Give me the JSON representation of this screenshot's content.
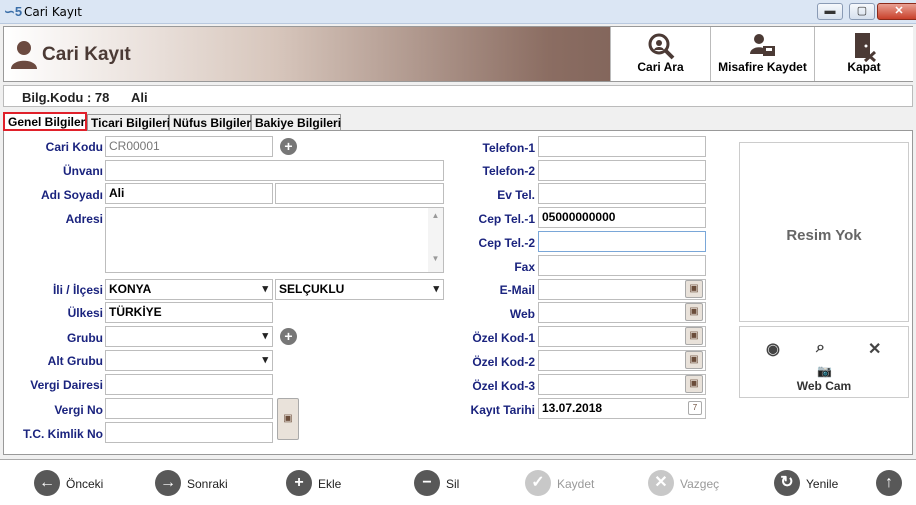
{
  "window": {
    "title": "Cari Kayıt"
  },
  "header": {
    "title": "Cari Kayıt"
  },
  "toolbar": {
    "search_label": "Cari Ara",
    "guest_label": "Misafire Kaydet",
    "close_label": "Kapat"
  },
  "info": {
    "code_label": "Bilg.Kodu : 78",
    "name": "Ali"
  },
  "tabs": [
    "Genel Bilgiler",
    "Ticari Bilgileri",
    "Nüfus Bilgileri",
    "Bakiye Bilgileri"
  ],
  "left": {
    "cari_kodu_label": "Cari Kodu",
    "cari_kodu": "CR00001",
    "unvani_label": "Ünvanı",
    "unvani": "",
    "adsoyad_label": "Adı Soyadı",
    "ad": "Ali",
    "soyad": "",
    "adres_label": "Adresi",
    "adres": "",
    "il_label": "İli / İlçesi",
    "il": "KONYA",
    "ilce": "SELÇUKLU",
    "ulke_label": "Ülkesi",
    "ulke": "TÜRKİYE",
    "grubu_label": "Grubu",
    "grubu": "",
    "altgrubu_label": "Alt Grubu",
    "altgrubu": "",
    "vdaire_label": "Vergi Dairesi",
    "vdaire": "",
    "vno_label": "Vergi No",
    "vno": "",
    "tc_label": "T.C. Kimlik No",
    "tc": ""
  },
  "right": {
    "tel1_label": "Telefon-1",
    "tel1": "",
    "tel2_label": "Telefon-2",
    "tel2": "",
    "evtel_label": "Ev Tel.",
    "evtel": "",
    "cep1_label": "Cep Tel.-1",
    "cep1": "05000000000",
    "cep2_label": "Cep Tel.-2",
    "cep2": "",
    "fax_label": "Fax",
    "fax": "",
    "email_label": "E-Mail",
    "email": "",
    "web_label": "Web",
    "web": "",
    "oz1_label": "Özel Kod-1",
    "oz1": "",
    "oz2_label": "Özel Kod-2",
    "oz2": "",
    "oz3_label": "Özel Kod-3",
    "oz3": "",
    "kt_label": "Kayıt Tarihi",
    "kt": "13.07.2018"
  },
  "photo": {
    "no_image": "Resim Yok",
    "webcam_label": "Web Cam"
  },
  "nav": {
    "prev": "Önceki",
    "next": "Sonraki",
    "add": "Ekle",
    "delete": "Sil",
    "save": "Kaydet",
    "cancel": "Vazgeç",
    "refresh": "Yenile"
  },
  "colors": {
    "label_blue": "#1a237e",
    "active_tab_border": "#e0202a",
    "header_dark": "#5e4640"
  }
}
